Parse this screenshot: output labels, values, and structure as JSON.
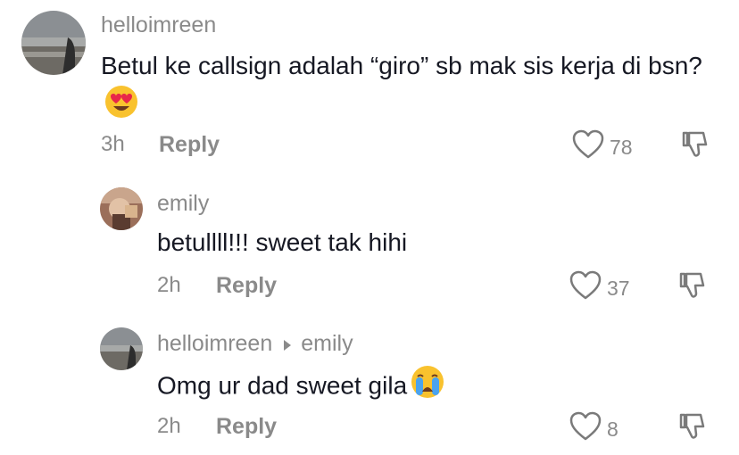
{
  "comments": [
    {
      "username": "helloimreen",
      "text": "Betul ke callsign adalah “giro” sb mak sis kerja di bsn?",
      "emoji": "heart-eyes-emoji",
      "time": "3h",
      "reply_label": "Reply",
      "likes": "78"
    },
    {
      "username": "emily",
      "text": "betullll!!! sweet tak hihi",
      "time": "2h",
      "reply_label": "Reply",
      "likes": "37"
    },
    {
      "username": "helloimreen",
      "reply_to": "emily",
      "text": "Omg ur dad sweet gila",
      "emoji": "loudly-crying-emoji",
      "time": "2h",
      "reply_label": "Reply",
      "likes": "8"
    }
  ],
  "colors": {
    "text": "#161823",
    "secondary": "#8a8a8a",
    "emoji_yellow": "#f9c22e",
    "heart_red": "#e8264a"
  }
}
